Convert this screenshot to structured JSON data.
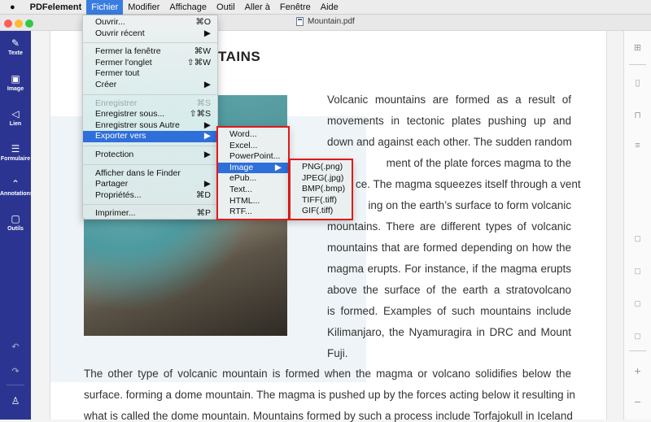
{
  "menubar": {
    "apple": "",
    "app": "PDFelement",
    "items": [
      "Fichier",
      "Modifier",
      "Affichage",
      "Outil",
      "Aller à",
      "Fenêtre",
      "Aide"
    ]
  },
  "window": {
    "title": "Mountain.pdf",
    "traffic_colors": [
      "#fc5f57",
      "#fdbc2e",
      "#33c748"
    ]
  },
  "sidebar": {
    "color": "#2b3591",
    "items": [
      {
        "label": "Texte",
        "icon": "pencil-icon"
      },
      {
        "label": "Image",
        "icon": "image-icon"
      },
      {
        "label": "Lien",
        "icon": "link-send-icon"
      },
      {
        "label": "Formulaire",
        "icon": "form-icon"
      },
      {
        "label": "Annotations",
        "icon": "annotations-icon"
      },
      {
        "label": "Outils",
        "icon": "tools-icon"
      }
    ],
    "bottom": [
      "undo-icon",
      "redo-icon",
      "user-icon"
    ]
  },
  "right_toolbar": [
    "thumbnails-icon",
    "page-icon",
    "bookmark-icon",
    "outline-icon",
    "actual-size-icon",
    "fit-width-icon",
    "fit-page-icon",
    "rotate-icon",
    "zoom-in-icon",
    "zoom-out-icon"
  ],
  "document": {
    "heading": "TAINS",
    "right_lines": [
      "Volcanic mountains are formed as a result of",
      "movements in tectonic plates pushing up and",
      "down and against each other. The sudden random",
      "ment of the plate forces magma to the",
      "ce. The magma squeezes itself through a vent",
      "ing on the earth’s surface to form volcanic",
      "mountains. There are different types of volcanic",
      "mountains that are formed depending on how the",
      "magma erupts. For instance, if the magma erupts",
      "above the surface of the earth a stratovolcano",
      "is formed. Examples of such mountains include",
      "Kilimanjaro, the Nyamuragira in DRC and Mount",
      "Fuji."
    ],
    "full_lines": [
      "The other type of volcanic mountain is formed when the magma or volcano solidifies below the",
      "surface. forming a dome mountain. The magma is pushed up by the forces acting below it resulting in",
      "what is called the dome mountain. Mountains formed by such a process include Torfajokull in Iceland"
    ]
  },
  "file_menu": {
    "items": [
      {
        "label": "Ouvrir...",
        "shortcut": "⌘O"
      },
      {
        "label": "Ouvrir récent",
        "shortcut": "▶"
      },
      {
        "sep": true
      },
      {
        "label": "Fermer la fenêtre",
        "shortcut": "⌘W"
      },
      {
        "label": "Fermer l'onglet",
        "shortcut": "⇧⌘W"
      },
      {
        "label": "Fermer tout",
        "shortcut": ""
      },
      {
        "label": "Créer",
        "shortcut": "▶"
      },
      {
        "sep": true
      },
      {
        "label": "Enregistrer",
        "shortcut": "⌘S",
        "disabled": true
      },
      {
        "label": "Enregistrer sous...",
        "shortcut": "⇧⌘S"
      },
      {
        "label": "Enregistrer sous Autre",
        "shortcut": "▶"
      },
      {
        "label": "Exporter vers",
        "shortcut": "▶",
        "highlighted": true
      },
      {
        "sep": true
      },
      {
        "label": "Protection",
        "shortcut": "▶"
      },
      {
        "sep": true
      },
      {
        "label": "Afficher dans le Finder",
        "shortcut": ""
      },
      {
        "label": "Partager",
        "shortcut": "▶"
      },
      {
        "label": "Propriétés...",
        "shortcut": "⌘D"
      },
      {
        "sep": true
      },
      {
        "label": "Imprimer...",
        "shortcut": "⌘P"
      }
    ]
  },
  "export_menu": {
    "items": [
      {
        "label": "Word...",
        "shortcut": ""
      },
      {
        "label": "Excel...",
        "shortcut": ""
      },
      {
        "label": "PowerPoint...",
        "shortcut": ""
      },
      {
        "label": "Image",
        "shortcut": "▶",
        "highlighted": true
      },
      {
        "label": "ePub...",
        "shortcut": ""
      },
      {
        "label": "Text...",
        "shortcut": ""
      },
      {
        "label": "HTML...",
        "shortcut": ""
      },
      {
        "label": "RTF...",
        "shortcut": ""
      }
    ]
  },
  "image_menu": {
    "items": [
      {
        "label": "PNG(.png)"
      },
      {
        "label": "JPEG(.jpg)"
      },
      {
        "label": "BMP(.bmp)"
      },
      {
        "label": "TIFF(.tiff)"
      },
      {
        "label": "GIF(.tiff)"
      }
    ]
  },
  "highlight_color": "#e01a1a"
}
